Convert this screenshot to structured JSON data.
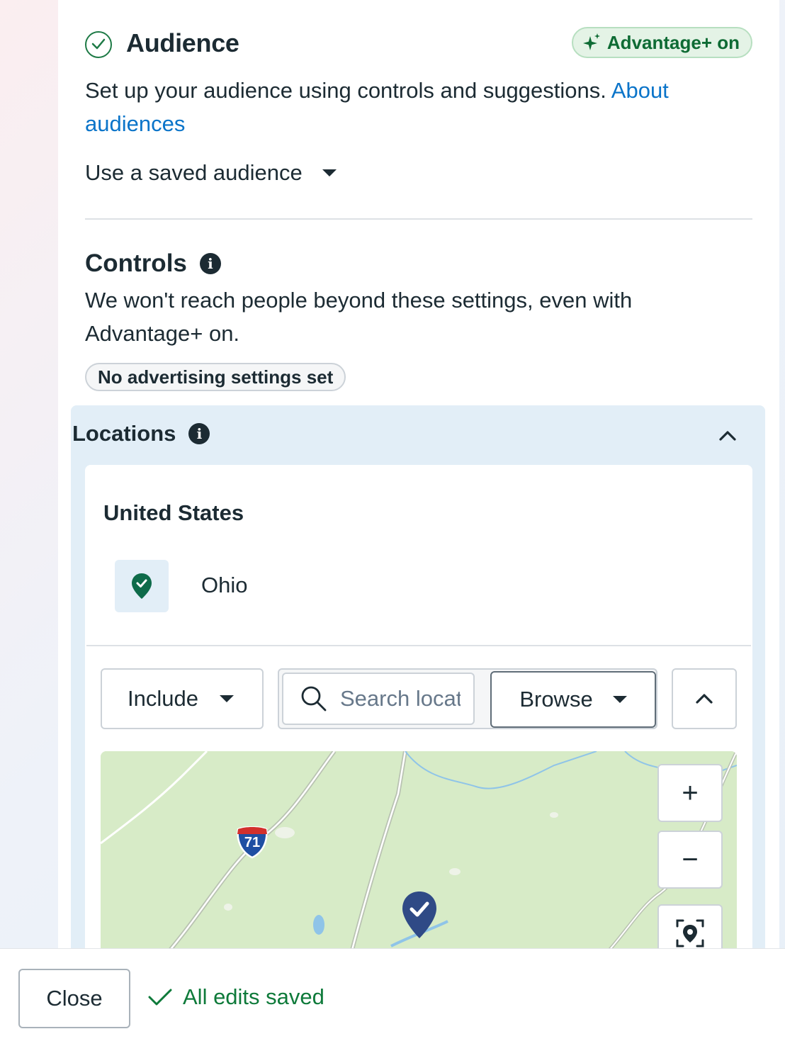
{
  "audience": {
    "title": "Audience",
    "advantage_badge": "Advantage+ on",
    "description": "Set up your audience using controls and suggestions.",
    "about_link": "About audiences",
    "saved_audience_label": "Use a saved audience"
  },
  "controls": {
    "title": "Controls",
    "description": "We won't reach people beyond these settings, even with Advantage+ on.",
    "badge": "No advertising settings set"
  },
  "locations": {
    "title": "Locations",
    "country": "United States",
    "regions": [
      "Ohio"
    ],
    "include_label": "Include",
    "search_placeholder": "Search locations",
    "browse_label": "Browse",
    "highway_shield": "71",
    "map_controls": {
      "zoom_in": "+",
      "zoom_out": "−"
    }
  },
  "footer": {
    "close_label": "Close",
    "status": "All edits saved"
  },
  "colors": {
    "accent_green": "#0e7a3a",
    "link_blue": "#0a74c9",
    "locations_bg": "#e2eef7",
    "map_green": "#d7ebc7",
    "pin_navy": "#2f4a86"
  }
}
